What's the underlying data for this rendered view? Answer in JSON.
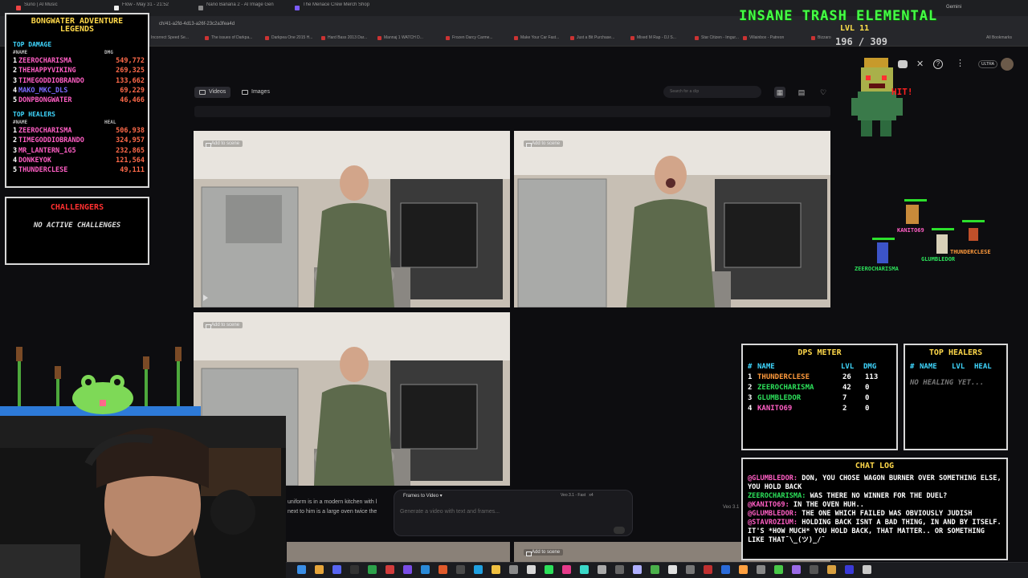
{
  "browser": {
    "tabs": [
      {
        "label": "Suno | AI Music",
        "color": "#e44"
      },
      {
        "label": "Flow - May 31 - 21:52",
        "color": "#eee"
      },
      {
        "label": "Nano Banana 2 - AI Image Gen",
        "color": "#888"
      },
      {
        "label": "The Menace Crew Merch Shop",
        "color": "#7c5cff"
      }
    ],
    "url": "ch/41-a2fd-4d13-a26f-23c2a3fea4d",
    "bookmarks": [
      "Incorrect Speed Se...",
      "The issues of Darkpa...",
      "Darkpea One 2015 H...",
      "Hard Bass 2013 Dar...",
      "Mannaj 1 WATCH D...",
      "Frozen Darcy Carme...",
      "Make Your Car Fast...",
      "Just a Bit Purchase...",
      "Mixed M Rap - DJ S...",
      "Star Citizen - Imgur...",
      "Villainbox - Patreon",
      "Bizzaro"
    ],
    "bookmarks_right": "All Bookmarks",
    "profile_label": "Gemini",
    "ultra_badge": "ULTRA"
  },
  "flow": {
    "filters": [
      {
        "label": "Videos",
        "active": true
      },
      {
        "label": "Images",
        "active": false
      }
    ],
    "search_placeholder": "Search for a clip",
    "add_to_scene": "Add to scene",
    "prompt_mode": "Frames to Video",
    "prompt_model": "Veo 3.1 - Fast",
    "prompt_count": "x4",
    "prompt_placeholder": "Generate a video with text and frames...",
    "description_line1": "uniform is in a modern kitchen with l",
    "description_line2": "next to him is a large oven twice the",
    "veo_label": "Veo 3.1"
  },
  "overlay": {
    "dmg_panel": {
      "title_line1": "BONGWATER ADVENTURE",
      "title_line2": "LEGENDS",
      "damage_header": "TOP DAMAGE",
      "col_name": "#NAME",
      "col_dmg": "DMG",
      "damage": [
        {
          "rank": "1",
          "name": "ZEEROCHARISMA",
          "value": "549,772",
          "color": "#ff5ec4"
        },
        {
          "rank": "2",
          "name": "THEHAPPYVIKING",
          "value": "269,325",
          "color": "#ff5ec4"
        },
        {
          "rank": "3",
          "name": "TIMEGODDIOBRANDO",
          "value": "133,662",
          "color": "#ff5ec4"
        },
        {
          "rank": "4",
          "name": "MAKO_MKC_DLS",
          "value": "69,229",
          "color": "#7d6bff"
        },
        {
          "rank": "5",
          "name": "DONPBONGWATER",
          "value": "46,466",
          "color": "#ff5ec4"
        }
      ],
      "healers_header": "TOP HEALERS",
      "col_heal": "HEAL",
      "healers": [
        {
          "rank": "1",
          "name": "ZEEROCHARISMA",
          "value": "506,938",
          "color": "#ff5ec4"
        },
        {
          "rank": "2",
          "name": "TIMEGODDIOBRANDO",
          "value": "324,957",
          "color": "#ff5ec4"
        },
        {
          "rank": "3",
          "name": "MR_LANTERN_1G5",
          "value": "232,865",
          "color": "#ff5ec4"
        },
        {
          "rank": "4",
          "name": "DONKEYOK",
          "value": "121,564",
          "color": "#ff5ec4"
        },
        {
          "rank": "5",
          "name": "THUNDERCLESE",
          "value": "49,111",
          "color": "#ff5ec4"
        }
      ]
    },
    "challengers": {
      "title": "CHALLENGERS",
      "text": "NO ACTIVE CHALLENGES"
    },
    "boss": {
      "name": "INSANE TRASH ELEMENTAL",
      "level": "LVL 11",
      "hp": "196 / 309",
      "hit_text": "HIT!"
    },
    "players": [
      {
        "name": "KANITO69",
        "color": "#ff5ec4"
      },
      {
        "name": "ZEEROCHARISMA",
        "color": "#2ce05a"
      },
      {
        "name": "GLUMBLEDOR",
        "color": "#2ce05a"
      },
      {
        "name": "THUNDERCLESE",
        "color": "#ff9a3c"
      }
    ],
    "dps_meter": {
      "title": "DPS METER",
      "cols": [
        "#",
        "NAME",
        "LVL",
        "DMG"
      ],
      "rows": [
        {
          "rank": "1",
          "name": "THUNDERCLESE",
          "lvl": "26",
          "dmg": "113",
          "color": "#ff9a3c"
        },
        {
          "rank": "2",
          "name": "ZEEROCHARISMA",
          "lvl": "42",
          "dmg": "0",
          "color": "#2ce05a"
        },
        {
          "rank": "3",
          "name": "GLUMBLEDOR",
          "lvl": "7",
          "dmg": "0",
          "color": "#2ce05a"
        },
        {
          "rank": "4",
          "name": "KANITO69",
          "lvl": "2",
          "dmg": "0",
          "color": "#ff5ec4"
        }
      ]
    },
    "heal_meter": {
      "title": "TOP HEALERS",
      "cols": [
        "#",
        "NAME",
        "LVL",
        "HEAL"
      ],
      "empty": "NO HEALING YET..."
    },
    "chat": {
      "title": "CHAT LOG",
      "lines": [
        {
          "user": "@GLUMBLEDOR:",
          "msg": " DON, YOU CHOSE WAGON BURNER OVER SOMETHING ELSE, YOU HOLD BACK",
          "color": "#ff5ec4"
        },
        {
          "user": "ZEEROCHARISMA:",
          "msg": " WAS THERE NO WINNER FOR THE DUEL?",
          "color": "#2ce05a"
        },
        {
          "user": "@KANITO69:",
          "msg": " IN THE OVEN HUH..",
          "color": "#ff5ec4"
        },
        {
          "user": "@GLUMBLEDOR:",
          "msg": " THE ONE WHICH FAILED WAS OBVIOUSLY JUDISH",
          "color": "#ff5ec4"
        },
        {
          "user": "@STAVROZIUM:",
          "msg": " HOLDING BACK ISNT A BAD THING, IN AND BY ITSELF. IT'S *HOW MUCH* YOU HOLD BACK, THAT MATTER.. OR SOMETHING LIKE THAT¯\\_(ツ)_/¯",
          "color": "#ff5ec4"
        }
      ]
    }
  },
  "taskbar": {
    "clock_time": "",
    "icons": [
      "file-explorer",
      "browser",
      "discord",
      "obs",
      "terminal"
    ]
  }
}
